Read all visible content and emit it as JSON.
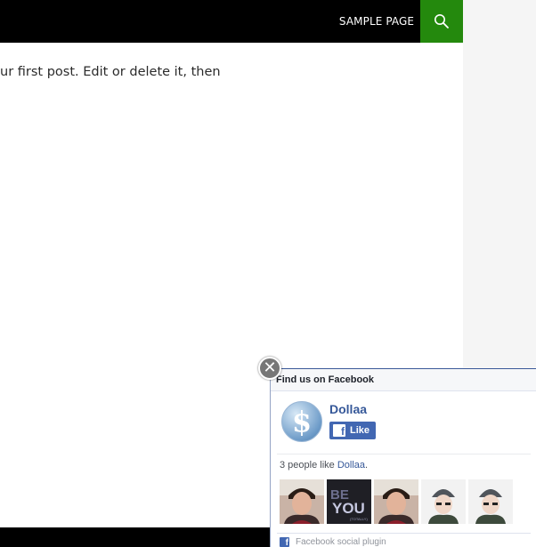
{
  "header": {
    "nav": [
      {
        "label": "SAMPLE PAGE"
      }
    ],
    "search_icon": "search-icon",
    "accent": "#24890d"
  },
  "content": {
    "post_excerpt": "ur first post. Edit or delete it, then"
  },
  "fb_widget": {
    "title": "Find us on Facebook",
    "page_name": "Dollaa",
    "like_label": "Like",
    "likes_prefix": "3 people like ",
    "likes_page": "Dollaa",
    "likes_suffix": ".",
    "footer": "Facebook social plugin",
    "close_icon": "close-icon",
    "brand_color": "#4267b2",
    "faces": [
      {
        "name": "face-1"
      },
      {
        "name": "face-2",
        "text_big": "BE",
        "text_big2": "YOU",
        "text_small": "(TOTALLY)"
      },
      {
        "name": "face-3"
      },
      {
        "name": "face-4"
      },
      {
        "name": "face-5"
      }
    ]
  }
}
